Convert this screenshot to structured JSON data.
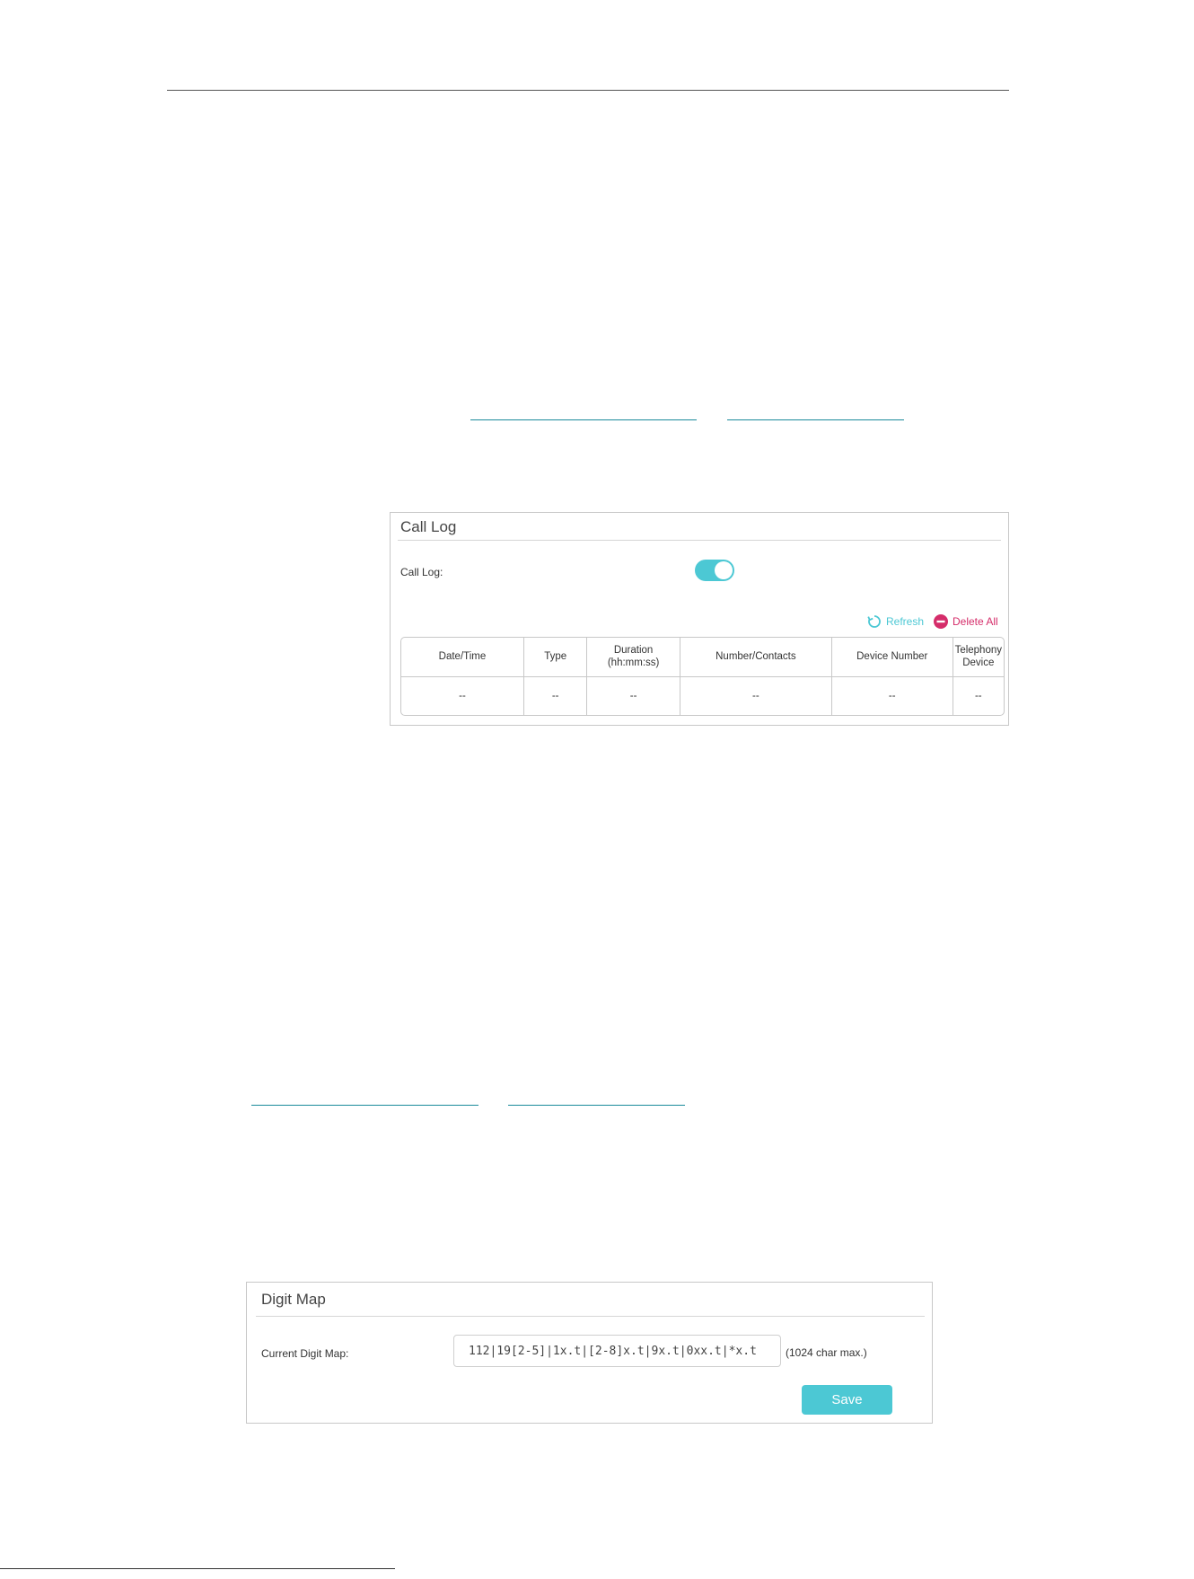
{
  "call_log_panel": {
    "title": "Call Log",
    "toggle_label": "Call Log:",
    "toggle_on": true,
    "refresh_label": "Refresh",
    "delete_all_label": "Delete All",
    "columns": [
      "Date/Time",
      "Type",
      "Duration\n(hh:mm:ss)",
      "Number/Contacts",
      "Device Number",
      "Telephony\nDevice"
    ],
    "rows": [
      [
        "--",
        "--",
        "--",
        "--",
        "--",
        "--"
      ]
    ]
  },
  "digit_map_panel": {
    "title": "Digit Map",
    "field_label": "Current Digit Map:",
    "field_value": "112|19[2-5]|1x.t|[2-8]x.t|9x.t|0xx.t|*x.t",
    "hint": "(1024 char max.)",
    "save_label": "Save"
  },
  "colors": {
    "accent": "#4cc8d4",
    "danger": "#d52d6a"
  }
}
